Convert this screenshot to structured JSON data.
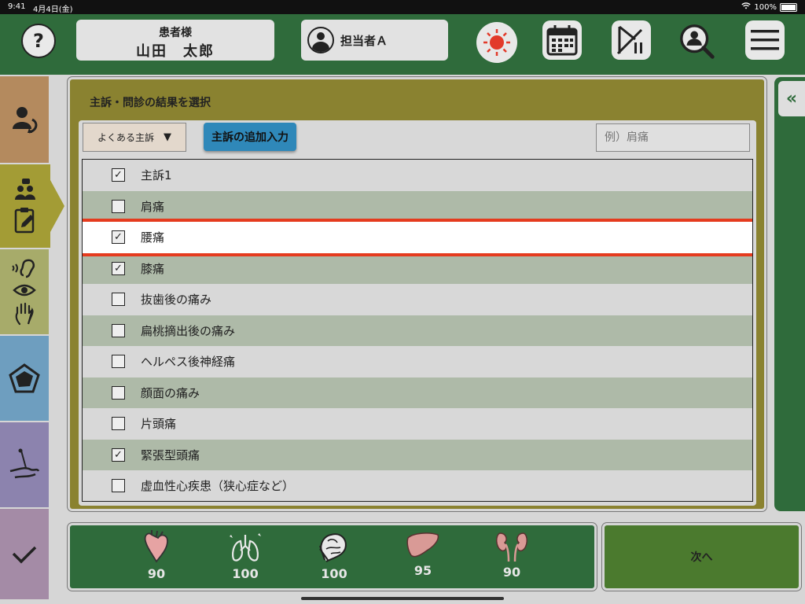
{
  "status": {
    "time": "9:41",
    "date": "4月4日(金)",
    "battery": "100%"
  },
  "header": {
    "help": "?",
    "patient_label": "患者様",
    "patient_name": "山田　太郎",
    "staff_name": "担当者Ａ"
  },
  "panel": {
    "title": "主訴・問診の結果を選択",
    "dropdown_label": "よくある主訴",
    "dropdown_arrow": "▼",
    "add_button": "主訴の追加入力",
    "search_placeholder": "例）肩痛"
  },
  "items": [
    {
      "label": "主訴1",
      "checked": true
    },
    {
      "label": "肩痛",
      "checked": false
    },
    {
      "label": "腰痛",
      "checked": true
    },
    {
      "label": "膝痛",
      "checked": true
    },
    {
      "label": "抜歯後の痛み",
      "checked": false
    },
    {
      "label": "扁桃摘出後の痛み",
      "checked": false
    },
    {
      "label": "ヘルペス後神経痛",
      "checked": false
    },
    {
      "label": "顔面の痛み",
      "checked": false
    },
    {
      "label": "片頭痛",
      "checked": false
    },
    {
      "label": "緊張型頭痛",
      "checked": true
    },
    {
      "label": "虚血性心疾患（狭心症など）",
      "checked": false
    }
  ],
  "selected_index": 2,
  "right_panel": {
    "collapse": "«"
  },
  "organs": [
    {
      "name": "heart-icon",
      "value": "90"
    },
    {
      "name": "lungs-icon",
      "value": "100"
    },
    {
      "name": "brain-icon",
      "value": "100"
    },
    {
      "name": "liver-icon",
      "value": "95"
    },
    {
      "name": "kidneys-icon",
      "value": "90"
    }
  ],
  "footer": {
    "next": "次へ"
  },
  "colors": {
    "accent_red": "#e53b1e",
    "header_green": "#2f6b3b",
    "panel_olive": "#8a8230"
  }
}
